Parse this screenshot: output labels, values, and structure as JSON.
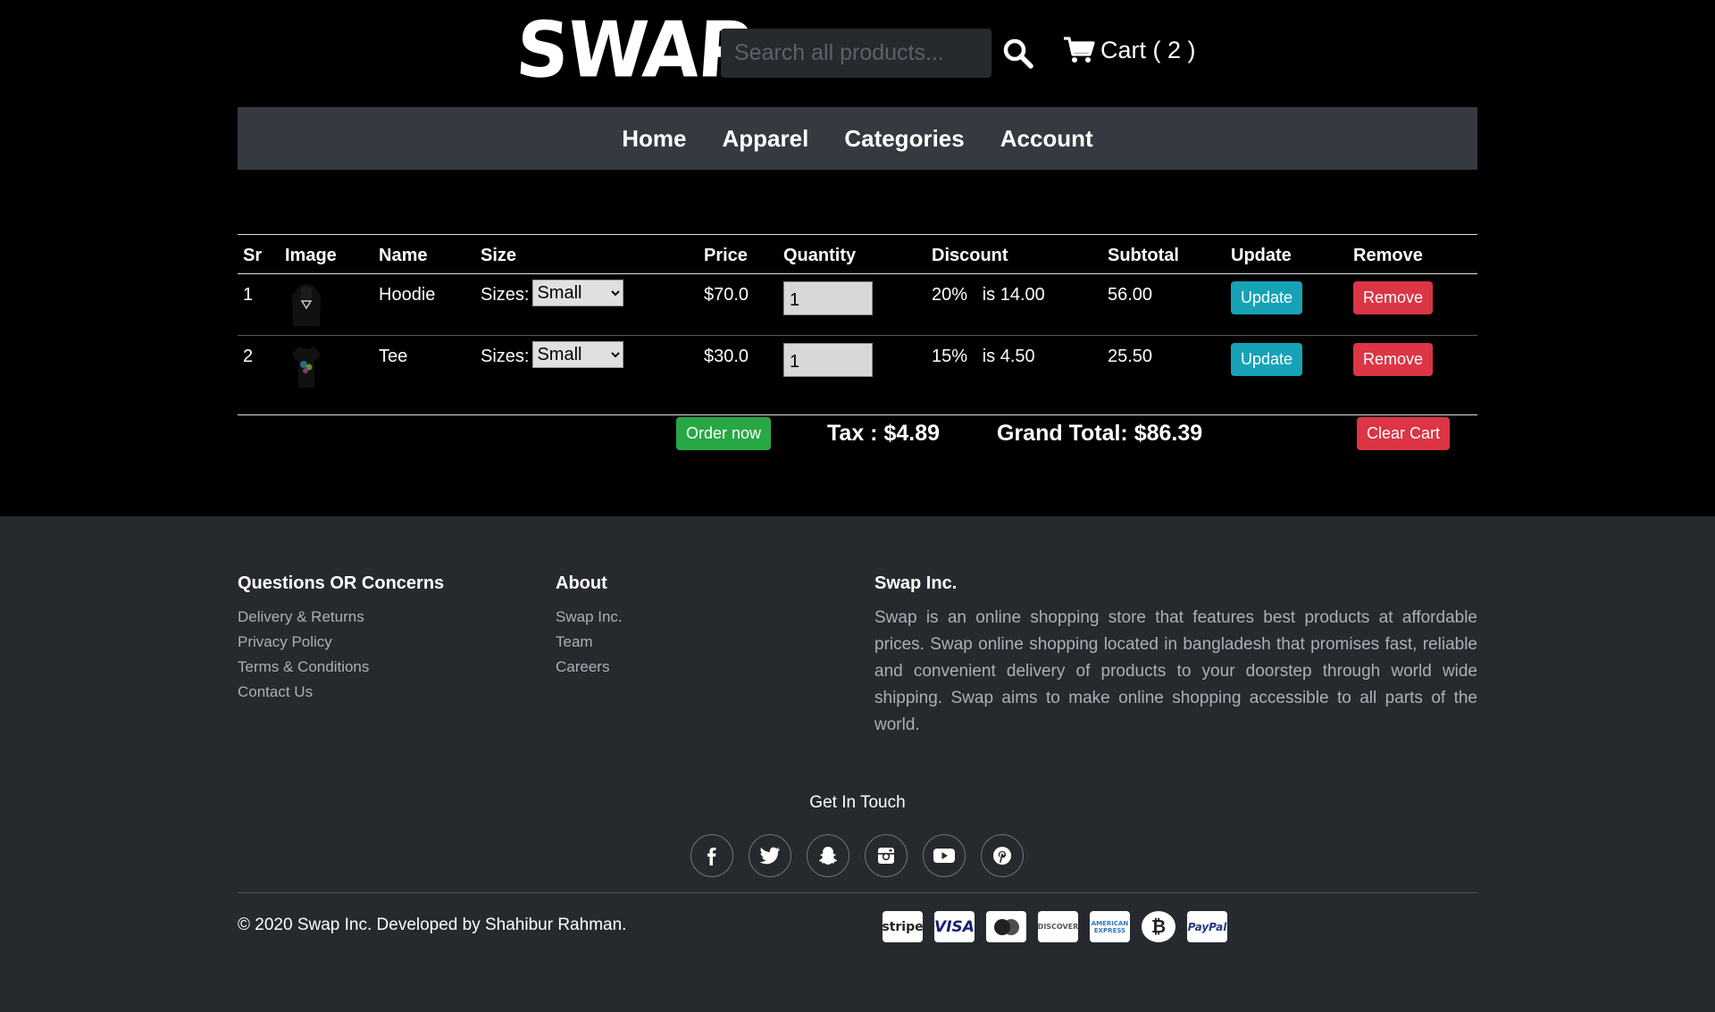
{
  "header": {
    "logo": "SWAP",
    "search_placeholder": "Search all products...",
    "cart_label": "Cart ( 2 )"
  },
  "nav": [
    "Home",
    "Apparel",
    "Categories",
    "Account"
  ],
  "table": {
    "headers": [
      "Sr",
      "Image",
      "Name",
      "Size",
      "Price",
      "Quantity",
      "Discount",
      "Subtotal",
      "Update",
      "Remove"
    ],
    "rows": [
      {
        "sr": "1",
        "name": "Hoodie",
        "size_label": "Sizes:",
        "size": "Small",
        "price": "$70.0",
        "qty": "1",
        "discount_pct": "20%",
        "discount_amt": "is 14.00",
        "subtotal": "56.00",
        "update": "Update",
        "remove": "Remove"
      },
      {
        "sr": "2",
        "name": "Tee",
        "size_label": "Sizes:",
        "size": "Small",
        "price": "$30.0",
        "qty": "1",
        "discount_pct": "15%",
        "discount_amt": "is 4.50",
        "subtotal": "25.50",
        "update": "Update",
        "remove": "Remove"
      }
    ]
  },
  "summary": {
    "order_now": "Order now",
    "tax": "Tax : $4.89",
    "grand_total": "Grand Total: $86.39",
    "clear_cart": "Clear Cart"
  },
  "footer": {
    "col1": {
      "title": "Questions OR Concerns",
      "links": [
        "Delivery & Returns",
        "Privacy Policy",
        "Terms & Conditions",
        "Contact Us"
      ]
    },
    "col2": {
      "title": "About",
      "links": [
        "Swap Inc.",
        "Team",
        "Careers"
      ]
    },
    "col3": {
      "title": "Swap Inc.",
      "text": "Swap is an online shopping store that features best products at affordable prices. Swap online shopping located in bangladesh that promises fast, reliable and convenient delivery of products to your doorstep through world wide shipping. Swap aims to make online shopping accessible to all parts of the world."
    },
    "get_in_touch": "Get In Touch",
    "socials": [
      "facebook-icon",
      "twitter-icon",
      "snapchat-icon",
      "instagram-icon",
      "youtube-icon",
      "pinterest-icon"
    ],
    "copyright": "© 2020 Swap Inc. Developed by Shahibur Rahman.",
    "payments": [
      "stripe",
      "VISA",
      "",
      "DISCOVER",
      "AMERICAN EXPRESS",
      "₿",
      "PayPal"
    ]
  },
  "colors": {
    "info": "#17a2b8",
    "danger": "#dc3545",
    "success": "#28a745",
    "nav_bg": "#343a40",
    "footer_bg": "#262a2f"
  }
}
